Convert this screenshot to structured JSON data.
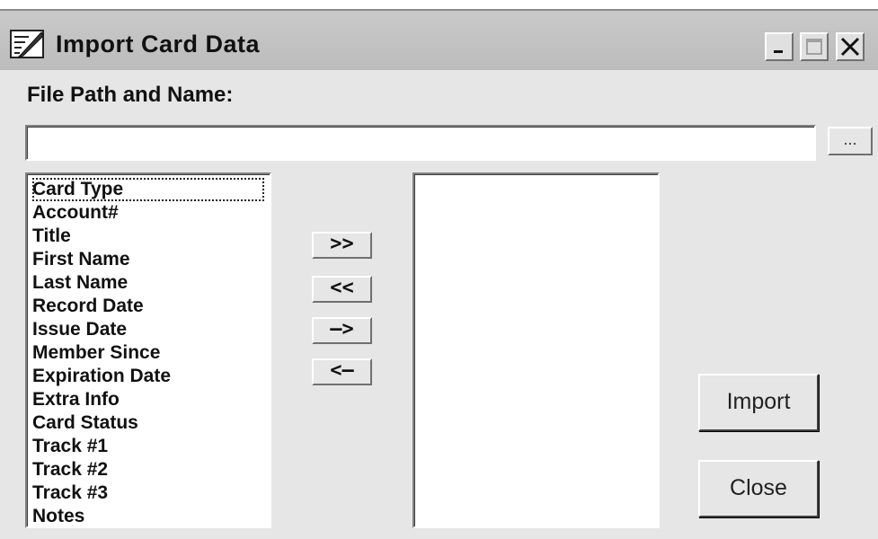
{
  "window": {
    "title": "Import Card Data",
    "icon": "edit-document-icon",
    "controls": {
      "minimize": "minimize-icon",
      "maximize": "maximize-icon",
      "close": "close-icon"
    }
  },
  "file": {
    "label": "File Path and Name:",
    "value": "",
    "browse_label": "..."
  },
  "available_fields": {
    "items": [
      "Card Type",
      "Account#",
      "Title",
      "First Name",
      "Last Name",
      "Record Date",
      "Issue Date",
      "Member Since",
      "Expiration Date",
      "Extra Info",
      "Card Status",
      "Track #1",
      "Track #2",
      "Track #3",
      "Notes"
    ],
    "selected_index": 0
  },
  "transfer_buttons": {
    "add_all": ">>",
    "remove_all": "<<",
    "add_one": "—>",
    "remove_one": "<—"
  },
  "selected_fields": {
    "items": []
  },
  "actions": {
    "import_label": "Import",
    "close_label": "Close"
  }
}
